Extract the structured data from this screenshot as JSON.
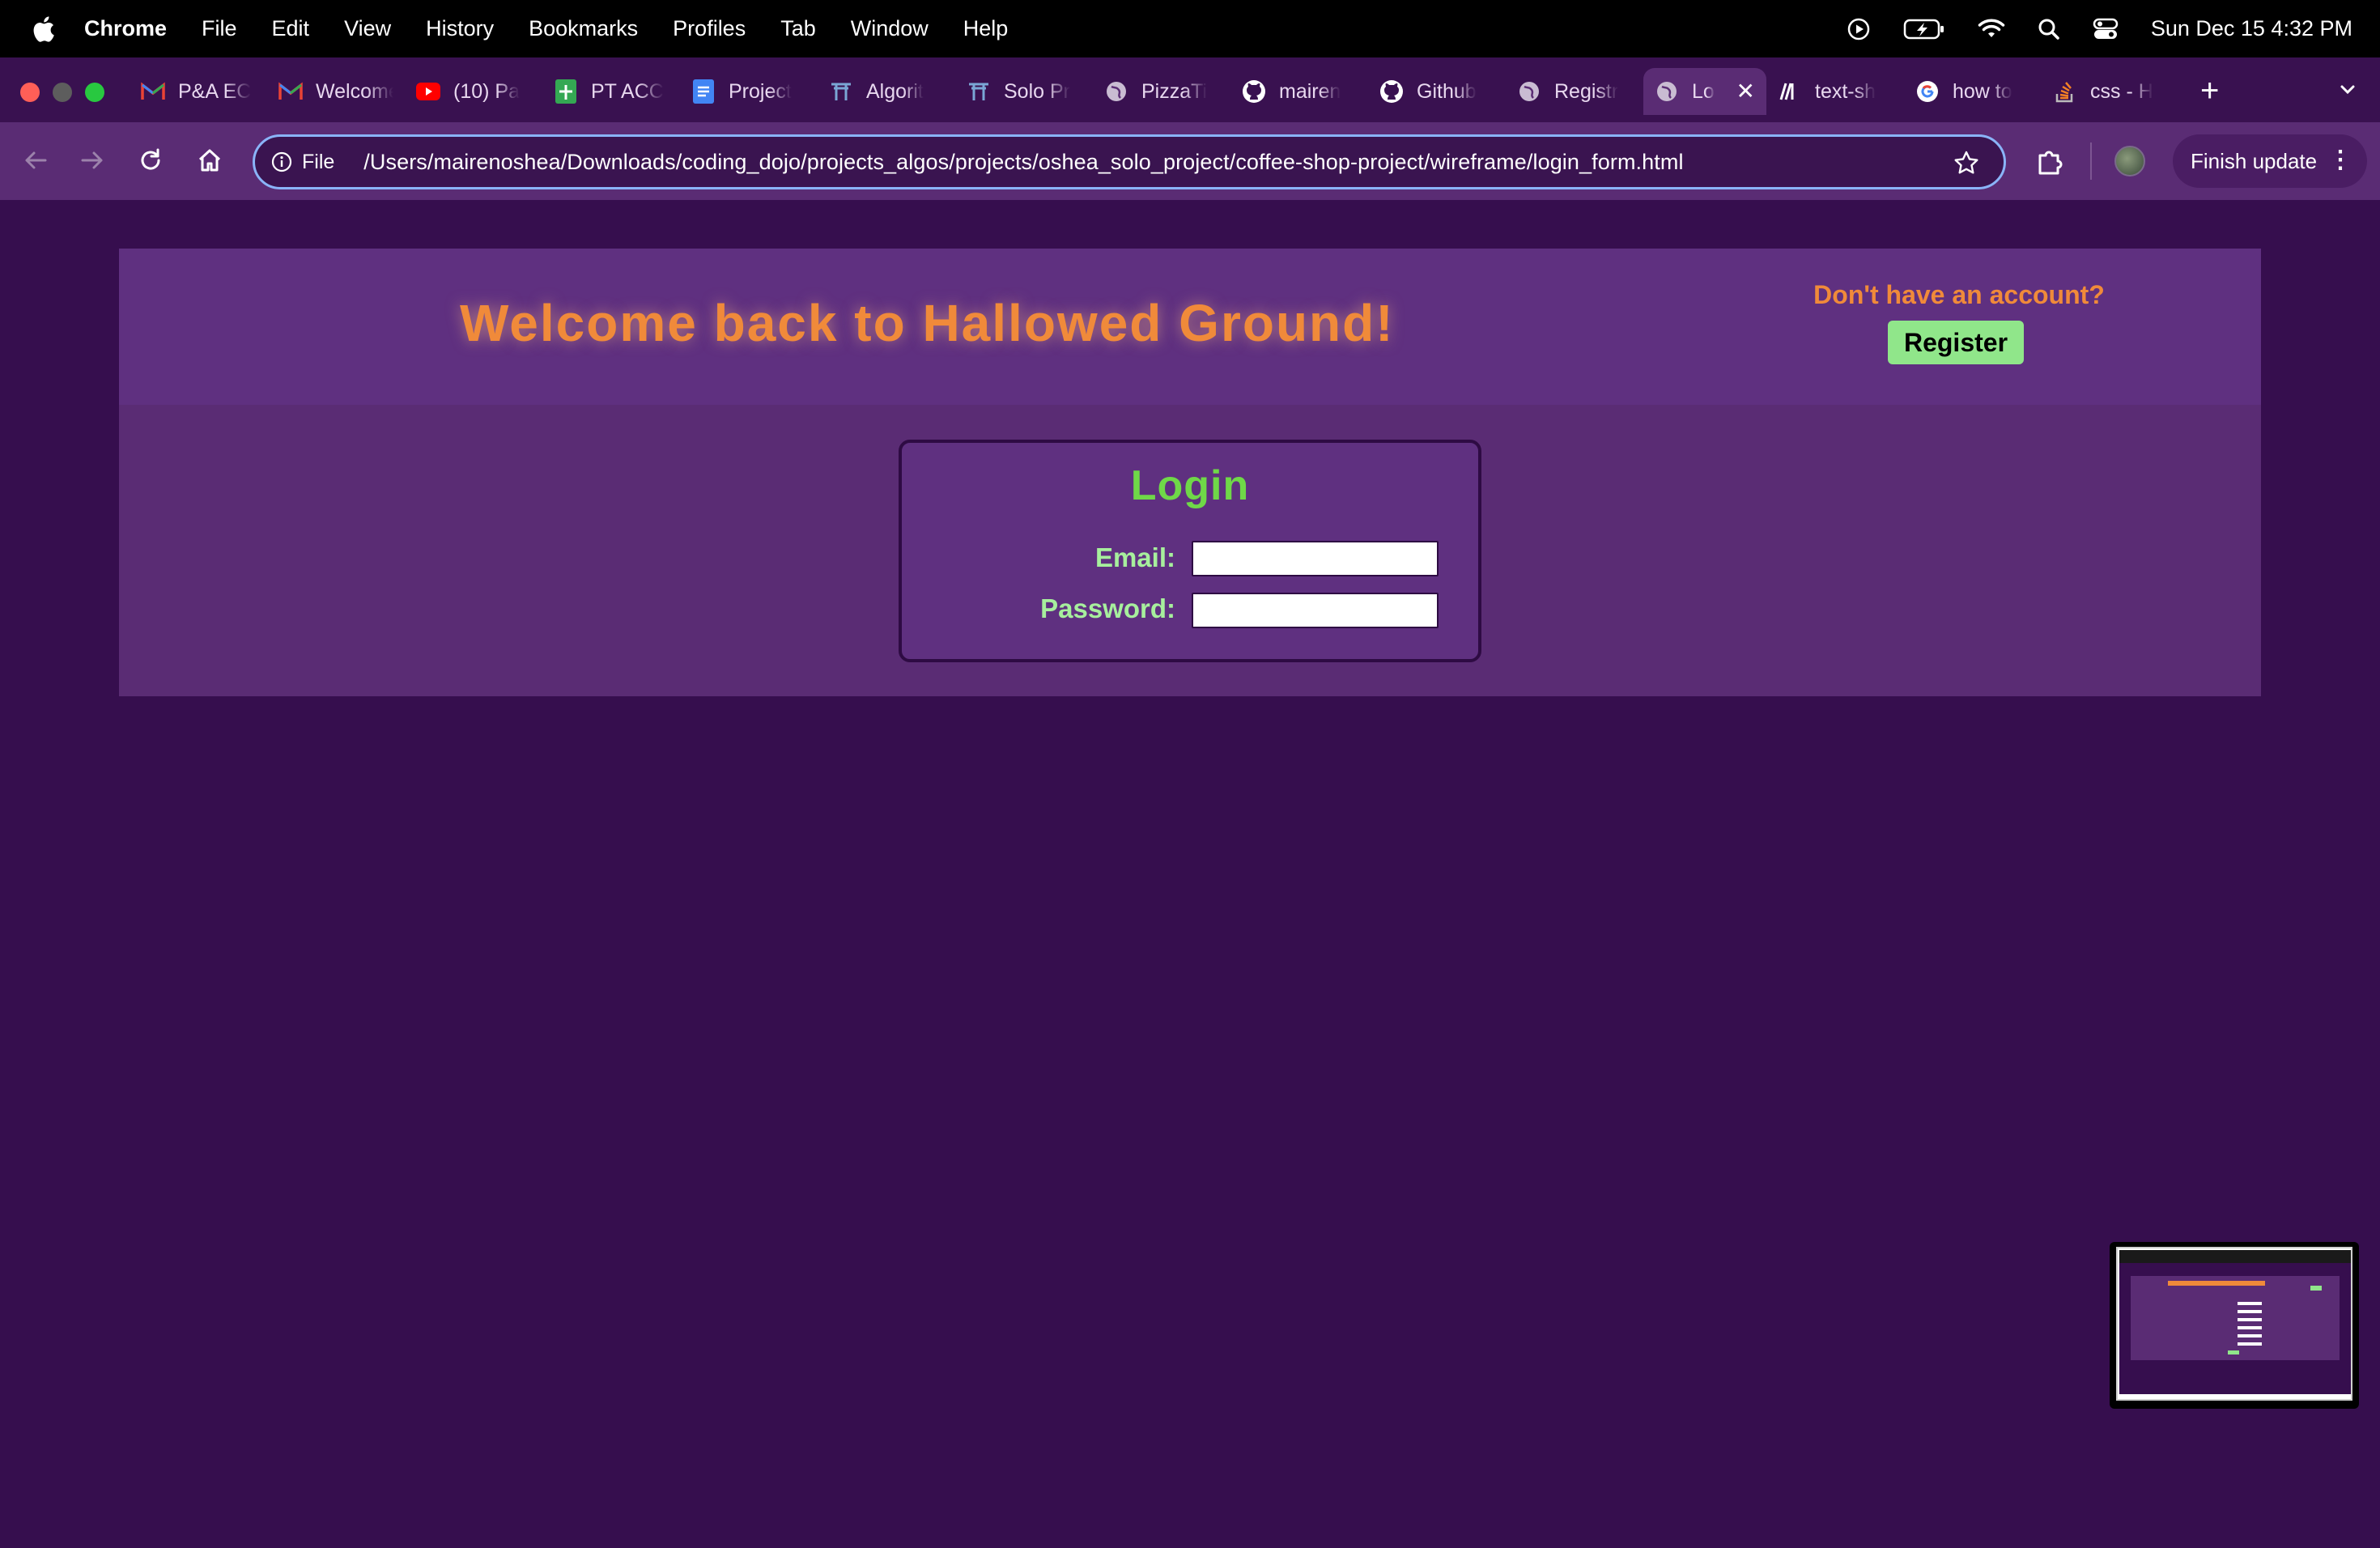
{
  "menubar": {
    "app_name": "Chrome",
    "items": [
      "File",
      "Edit",
      "View",
      "History",
      "Bookmarks",
      "Profiles",
      "Tab",
      "Window",
      "Help"
    ],
    "clock": "Sun Dec 15  4:32 PM"
  },
  "tabs": [
    {
      "title": "P&A EC",
      "icon": "gmail-icon"
    },
    {
      "title": "Welcome",
      "icon": "gmail-icon"
    },
    {
      "title": "(10) Pa",
      "icon": "youtube-icon"
    },
    {
      "title": "PT ACC",
      "icon": "sheets-icon"
    },
    {
      "title": "Project",
      "icon": "docs-icon"
    },
    {
      "title": "Algorit",
      "icon": "dojo-icon"
    },
    {
      "title": "Solo Pr",
      "icon": "dojo-icon"
    },
    {
      "title": "PizzaTi",
      "icon": "globe-icon"
    },
    {
      "title": "mairen",
      "icon": "github-icon"
    },
    {
      "title": "Github",
      "icon": "github-icon"
    },
    {
      "title": "Registr",
      "icon": "globe-icon"
    },
    {
      "title": "Lo",
      "icon": "globe-icon",
      "active": true
    },
    {
      "title": "text-sh",
      "icon": "mdn-icon"
    },
    {
      "title": "how to",
      "icon": "google-icon"
    },
    {
      "title": "css - H",
      "icon": "stackoverflow-icon"
    }
  ],
  "toolbar": {
    "file_label": "File",
    "url": "/Users/mairenoshea/Downloads/coding_dojo/projects_algos/projects/oshea_solo_project/coffee-shop-project/wireframe/login_form.html",
    "finish_update_label": "Finish update"
  },
  "page": {
    "headline": "Welcome back to Hallowed Ground!",
    "no_account_text": "Don't have an account?",
    "register_label": "Register",
    "login": {
      "title": "Login",
      "email_label": "Email:",
      "password_label": "Password:",
      "email_value": "",
      "password_value": ""
    }
  },
  "colors": {
    "background": "#360e4e",
    "panel": "#5a2c74",
    "header": "#5f3080",
    "accent_orange": "#f08a3a",
    "accent_green": "#6fd848",
    "button_green": "#90e68a"
  }
}
